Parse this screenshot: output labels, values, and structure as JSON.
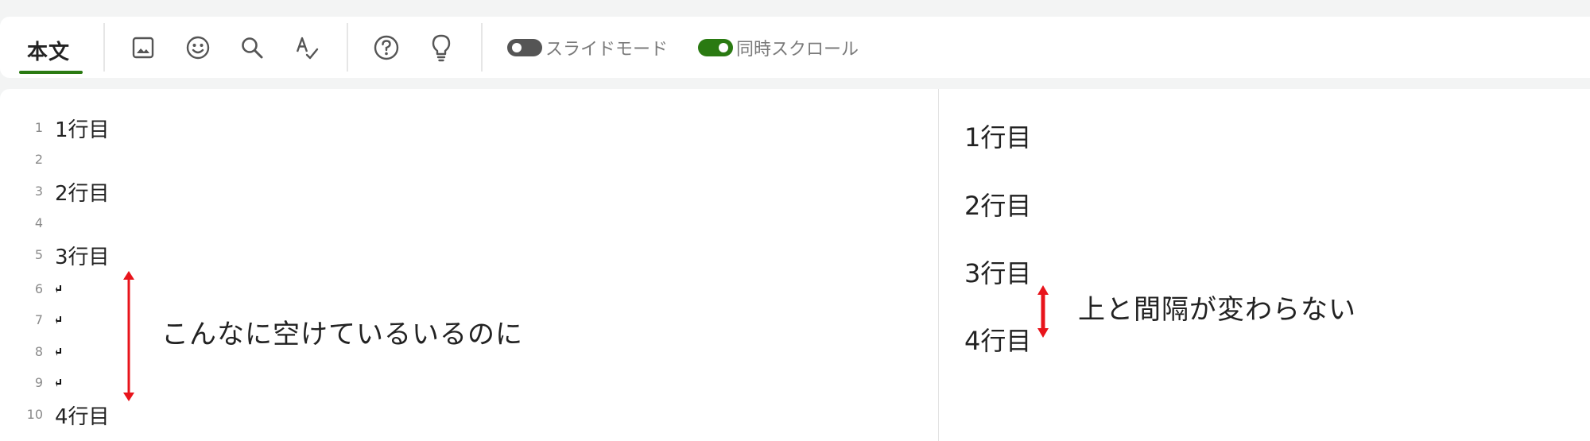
{
  "toolbar": {
    "tab_label": "本文",
    "tools": [
      {
        "name": "image-icon"
      },
      {
        "name": "emoji-icon"
      },
      {
        "name": "search-icon"
      },
      {
        "name": "spellcheck-icon"
      },
      {
        "name": "help-icon"
      },
      {
        "name": "lightbulb-icon"
      }
    ],
    "slide_mode": {
      "label": "スライドモード",
      "on": false
    },
    "sync_scroll": {
      "label": "同時スクロール",
      "on": true
    }
  },
  "editor": {
    "lines": [
      {
        "num": "1",
        "text": "1行目"
      },
      {
        "num": "2",
        "text": ""
      },
      {
        "num": "3",
        "text": "2行目"
      },
      {
        "num": "4",
        "text": ""
      },
      {
        "num": "5",
        "text": "3行目"
      },
      {
        "num": "6",
        "text": "",
        "return_mark": true
      },
      {
        "num": "7",
        "text": "",
        "return_mark": true
      },
      {
        "num": "8",
        "text": "",
        "return_mark": true
      },
      {
        "num": "9",
        "text": "",
        "return_mark": true
      },
      {
        "num": "10",
        "text": "4行目"
      }
    ],
    "annotation": "こんなに空けているいるのに"
  },
  "preview": {
    "lines": [
      "1行目",
      "2行目",
      "3行目",
      "4行目"
    ],
    "annotation": "上と間隔が変わらない"
  },
  "colors": {
    "accent": "#2a7a12",
    "toggle_off": "#555555",
    "arrow": "#e8141b"
  }
}
